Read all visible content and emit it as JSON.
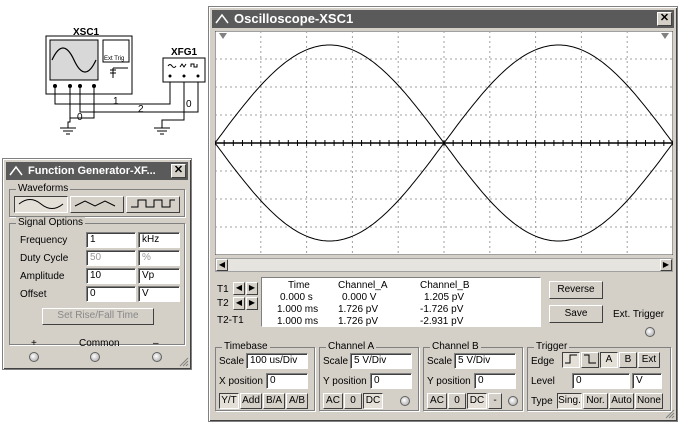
{
  "schematic": {
    "scope_label": "XSC1",
    "ext_trig_label": "Ext Trig",
    "fgen_label": "XFG1",
    "wire_labels": [
      "1",
      "2",
      "0",
      "0"
    ]
  },
  "function_generator": {
    "title": "Function Generator-XF...",
    "waveforms_label": "Waveforms",
    "signal_options_label": "Signal Options",
    "frequency": {
      "label": "Frequency",
      "value": "1",
      "unit": "kHz"
    },
    "duty_cycle": {
      "label": "Duty Cycle",
      "value": "50",
      "unit": "%"
    },
    "amplitude": {
      "label": "Amplitude",
      "value": "10",
      "unit": "Vp"
    },
    "offset": {
      "label": "Offset",
      "value": "0",
      "unit": "V"
    },
    "rise_fall_button": "Set Rise/Fall Time",
    "terminals": {
      "plus": "+",
      "common": "Common",
      "minus": "–"
    }
  },
  "oscilloscope": {
    "title": "Oscilloscope-XSC1",
    "readout": {
      "headers": [
        "Time",
        "Channel_A",
        "Channel_B"
      ],
      "rows": [
        {
          "label": "T1",
          "time": "0.000 s",
          "a": "0.000 V",
          "b": "1.205 pV"
        },
        {
          "label": "T2",
          "time": "1.000 ms",
          "a": "1.726 pV",
          "b": "-1.726 pV"
        },
        {
          "label": "T2-T1",
          "time": "1.000 ms",
          "a": "1.726 pV",
          "b": "-2.931 pV"
        }
      ]
    },
    "reverse_button": "Reverse",
    "save_button": "Save",
    "ext_trigger_label": "Ext. Trigger",
    "timebase": {
      "title": "Timebase",
      "scale_label": "Scale",
      "scale_value": "100 us/Div",
      "xpos_label": "X position",
      "xpos_value": "0",
      "modes": [
        "Y/T",
        "Add",
        "B/A",
        "A/B"
      ]
    },
    "channel_a": {
      "title": "Channel A",
      "scale_label": "Scale",
      "scale_value": "5  V/Div",
      "ypos_label": "Y position",
      "ypos_value": "0",
      "coupling": [
        "AC",
        "0",
        "DC"
      ]
    },
    "channel_b": {
      "title": "Channel B",
      "scale_label": "Scale",
      "scale_value": "5  V/Div",
      "ypos_label": "Y position",
      "ypos_value": "0",
      "coupling": [
        "AC",
        "0",
        "DC",
        "-"
      ]
    },
    "trigger": {
      "title": "Trigger",
      "edge_label": "Edge",
      "edge_sources": [
        "A",
        "B",
        "Ext"
      ],
      "level_label": "Level",
      "level_value": "0",
      "level_unit": "V",
      "type_label": "Type",
      "types": [
        "Sing.",
        "Nor.",
        "Auto",
        "None"
      ]
    }
  }
}
